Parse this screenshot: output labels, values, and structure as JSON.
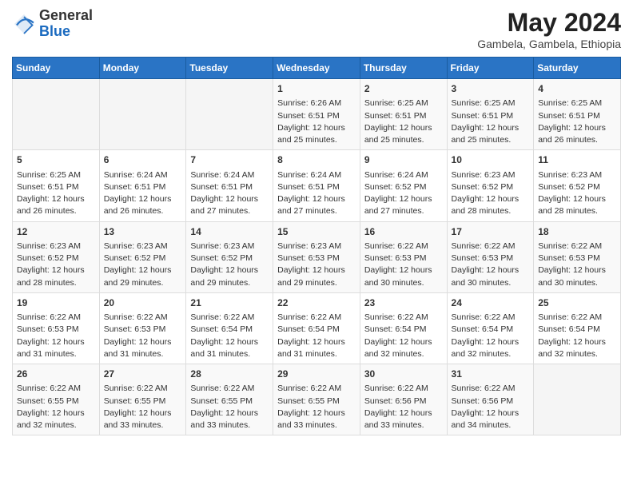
{
  "logo": {
    "general": "General",
    "blue": "Blue"
  },
  "header": {
    "month": "May 2024",
    "location": "Gambela, Gambela, Ethiopia"
  },
  "weekdays": [
    "Sunday",
    "Monday",
    "Tuesday",
    "Wednesday",
    "Thursday",
    "Friday",
    "Saturday"
  ],
  "weeks": [
    [
      {
        "day": "",
        "info": ""
      },
      {
        "day": "",
        "info": ""
      },
      {
        "day": "",
        "info": ""
      },
      {
        "day": "1",
        "info": "Sunrise: 6:26 AM\nSunset: 6:51 PM\nDaylight: 12 hours\nand 25 minutes."
      },
      {
        "day": "2",
        "info": "Sunrise: 6:25 AM\nSunset: 6:51 PM\nDaylight: 12 hours\nand 25 minutes."
      },
      {
        "day": "3",
        "info": "Sunrise: 6:25 AM\nSunset: 6:51 PM\nDaylight: 12 hours\nand 25 minutes."
      },
      {
        "day": "4",
        "info": "Sunrise: 6:25 AM\nSunset: 6:51 PM\nDaylight: 12 hours\nand 26 minutes."
      }
    ],
    [
      {
        "day": "5",
        "info": "Sunrise: 6:25 AM\nSunset: 6:51 PM\nDaylight: 12 hours\nand 26 minutes."
      },
      {
        "day": "6",
        "info": "Sunrise: 6:24 AM\nSunset: 6:51 PM\nDaylight: 12 hours\nand 26 minutes."
      },
      {
        "day": "7",
        "info": "Sunrise: 6:24 AM\nSunset: 6:51 PM\nDaylight: 12 hours\nand 27 minutes."
      },
      {
        "day": "8",
        "info": "Sunrise: 6:24 AM\nSunset: 6:51 PM\nDaylight: 12 hours\nand 27 minutes."
      },
      {
        "day": "9",
        "info": "Sunrise: 6:24 AM\nSunset: 6:52 PM\nDaylight: 12 hours\nand 27 minutes."
      },
      {
        "day": "10",
        "info": "Sunrise: 6:23 AM\nSunset: 6:52 PM\nDaylight: 12 hours\nand 28 minutes."
      },
      {
        "day": "11",
        "info": "Sunrise: 6:23 AM\nSunset: 6:52 PM\nDaylight: 12 hours\nand 28 minutes."
      }
    ],
    [
      {
        "day": "12",
        "info": "Sunrise: 6:23 AM\nSunset: 6:52 PM\nDaylight: 12 hours\nand 28 minutes."
      },
      {
        "day": "13",
        "info": "Sunrise: 6:23 AM\nSunset: 6:52 PM\nDaylight: 12 hours\nand 29 minutes."
      },
      {
        "day": "14",
        "info": "Sunrise: 6:23 AM\nSunset: 6:52 PM\nDaylight: 12 hours\nand 29 minutes."
      },
      {
        "day": "15",
        "info": "Sunrise: 6:23 AM\nSunset: 6:53 PM\nDaylight: 12 hours\nand 29 minutes."
      },
      {
        "day": "16",
        "info": "Sunrise: 6:22 AM\nSunset: 6:53 PM\nDaylight: 12 hours\nand 30 minutes."
      },
      {
        "day": "17",
        "info": "Sunrise: 6:22 AM\nSunset: 6:53 PM\nDaylight: 12 hours\nand 30 minutes."
      },
      {
        "day": "18",
        "info": "Sunrise: 6:22 AM\nSunset: 6:53 PM\nDaylight: 12 hours\nand 30 minutes."
      }
    ],
    [
      {
        "day": "19",
        "info": "Sunrise: 6:22 AM\nSunset: 6:53 PM\nDaylight: 12 hours\nand 31 minutes."
      },
      {
        "day": "20",
        "info": "Sunrise: 6:22 AM\nSunset: 6:53 PM\nDaylight: 12 hours\nand 31 minutes."
      },
      {
        "day": "21",
        "info": "Sunrise: 6:22 AM\nSunset: 6:54 PM\nDaylight: 12 hours\nand 31 minutes."
      },
      {
        "day": "22",
        "info": "Sunrise: 6:22 AM\nSunset: 6:54 PM\nDaylight: 12 hours\nand 31 minutes."
      },
      {
        "day": "23",
        "info": "Sunrise: 6:22 AM\nSunset: 6:54 PM\nDaylight: 12 hours\nand 32 minutes."
      },
      {
        "day": "24",
        "info": "Sunrise: 6:22 AM\nSunset: 6:54 PM\nDaylight: 12 hours\nand 32 minutes."
      },
      {
        "day": "25",
        "info": "Sunrise: 6:22 AM\nSunset: 6:54 PM\nDaylight: 12 hours\nand 32 minutes."
      }
    ],
    [
      {
        "day": "26",
        "info": "Sunrise: 6:22 AM\nSunset: 6:55 PM\nDaylight: 12 hours\nand 32 minutes."
      },
      {
        "day": "27",
        "info": "Sunrise: 6:22 AM\nSunset: 6:55 PM\nDaylight: 12 hours\nand 33 minutes."
      },
      {
        "day": "28",
        "info": "Sunrise: 6:22 AM\nSunset: 6:55 PM\nDaylight: 12 hours\nand 33 minutes."
      },
      {
        "day": "29",
        "info": "Sunrise: 6:22 AM\nSunset: 6:55 PM\nDaylight: 12 hours\nand 33 minutes."
      },
      {
        "day": "30",
        "info": "Sunrise: 6:22 AM\nSunset: 6:56 PM\nDaylight: 12 hours\nand 33 minutes."
      },
      {
        "day": "31",
        "info": "Sunrise: 6:22 AM\nSunset: 6:56 PM\nDaylight: 12 hours\nand 34 minutes."
      },
      {
        "day": "",
        "info": ""
      }
    ]
  ]
}
